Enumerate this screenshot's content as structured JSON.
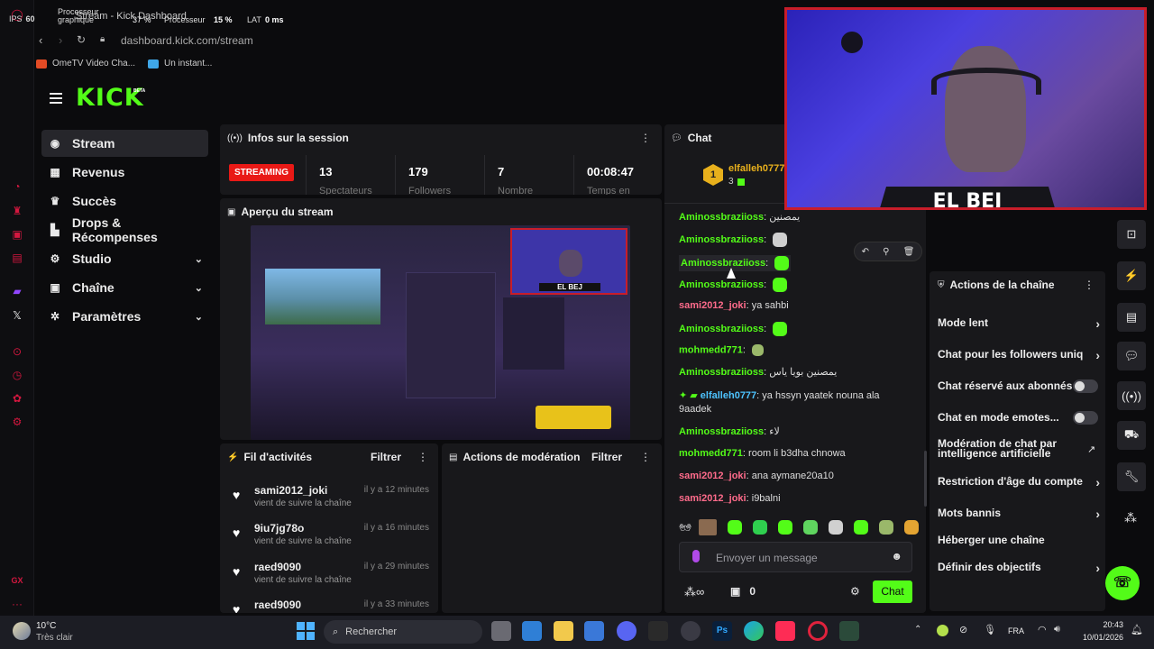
{
  "browser": {
    "perf": {
      "fps_label": "IPS",
      "fps_value": "60",
      "gpu_label": "Processeur graphique",
      "gpu_value": "37 %",
      "cpu_label": "Processeur",
      "cpu_value": "15 %",
      "lat_label": "LAT",
      "lat_value": "0 ms"
    },
    "tab_title": "Stream - Kick Dashboard",
    "url": "dashboard.kick.com/stream",
    "bookmarks": [
      "OmeTV Video Cha...",
      "Un instant..."
    ]
  },
  "sidebar": {
    "logo": "KICK",
    "beta": "BETA",
    "items": [
      {
        "label": "Stream",
        "icon": "broadcast-icon"
      },
      {
        "label": "Revenus",
        "icon": "chart-icon"
      },
      {
        "label": "Succès",
        "icon": "trophy-icon"
      },
      {
        "label": "Drops & Récompenses",
        "icon": "gift-icon"
      },
      {
        "label": "Studio",
        "icon": "gear-icon"
      },
      {
        "label": "Chaîne",
        "icon": "user-icon"
      },
      {
        "label": "Paramètres",
        "icon": "settings-icon"
      }
    ],
    "gx": "GX"
  },
  "session": {
    "title": "Infos sur la session",
    "badge": "STREAMING",
    "stats": [
      {
        "value": "13",
        "label": "Spectateurs"
      },
      {
        "value": "179",
        "label": "Followers"
      },
      {
        "value": "7",
        "label": "Nombre"
      },
      {
        "value": "00:08:47",
        "label": "Temps en"
      }
    ]
  },
  "preview": {
    "title": "Aperçu du stream",
    "overlay_name": "EL BEJ"
  },
  "feed": {
    "title": "Fil d'activités",
    "filter": "Filtrer",
    "items": [
      {
        "name": "sami2012_joki",
        "time": "il y a 12 minutes",
        "sub": "vient de suivre la chaîne"
      },
      {
        "name": "9iu7jg78o",
        "time": "il y a 16 minutes",
        "sub": "vient de suivre la chaîne"
      },
      {
        "name": "raed9090",
        "time": "il y a 29 minutes",
        "sub": "vient de suivre la chaîne"
      },
      {
        "name": "raed9090",
        "time": "il y a 33 minutes",
        "sub": ""
      }
    ]
  },
  "moderation": {
    "title": "Actions de modération",
    "filter": "Filtrer"
  },
  "chat": {
    "title": "Chat",
    "pinned_user": "elfalleh0777",
    "pinned_rank": "1",
    "pinned_count": "3",
    "messages": [
      {
        "user": "Aminossbraziioss",
        "text": "يمصنين",
        "color": "#53fc18"
      },
      {
        "user": "Aminossbraziioss",
        "text": "",
        "color": "#53fc18"
      },
      {
        "user": "Aminossbraziioss",
        "text": "",
        "color": "#53fc18"
      },
      {
        "user": "Aminossbraziioss",
        "text": "",
        "color": "#53fc18"
      },
      {
        "user": "sami2012_joki",
        "text": "ya sahbi",
        "color": "#ff6b8b"
      },
      {
        "user": "Aminossbraziioss",
        "text": "",
        "color": "#53fc18"
      },
      {
        "user": "mohmedd771",
        "text": "",
        "color": "#53fc18"
      },
      {
        "user": "Aminossbraziioss",
        "text": "يمصنين بويا ياس",
        "color": "#53fc18"
      },
      {
        "user": "elfalleh0777",
        "text": "ya hssyn yaatek nouna ala",
        "color": "#4dc3ff"
      },
      {
        "user": "",
        "text": "9aadek",
        "color": "#fff"
      },
      {
        "user": "Aminossbraziioss",
        "text": "لاء",
        "color": "#53fc18"
      },
      {
        "user": "mohmedd771",
        "text": "room li b3dha chnowa",
        "color": "#53fc18"
      },
      {
        "user": "sami2012_joki",
        "text": "ana aymane20a10",
        "color": "#ff6b8b"
      },
      {
        "user": "sami2012_joki",
        "text": "i9balni",
        "color": "#ff6b8b"
      }
    ],
    "placeholder": "Envoyer un message",
    "points": "0",
    "send": "Chat"
  },
  "actions": {
    "title": "Actions de la chaîne",
    "items": [
      {
        "label": "Mode lent",
        "control": "arrow"
      },
      {
        "label": "Chat pour les followers uniq",
        "control": "arrow"
      },
      {
        "label": "Chat réservé aux abonnés",
        "control": "toggle"
      },
      {
        "label": "Chat en mode emotes...",
        "control": "toggle"
      },
      {
        "label": "Modération de chat par intelligence artificielle",
        "control": "external"
      },
      {
        "label": "Restriction d'âge du compte",
        "control": "arrow"
      },
      {
        "label": "Mots bannis",
        "control": "arrow"
      },
      {
        "label": "Héberger une chaîne",
        "control": "none"
      },
      {
        "label": "Définir des objectifs",
        "control": "arrow"
      }
    ]
  },
  "webcam": {
    "name": "EL BEJ"
  },
  "taskbar": {
    "weather_temp": "10°C",
    "weather_desc": "Très clair",
    "search": "Rechercher",
    "lang": "FRA",
    "time": "20:43",
    "date": "10/01/2026"
  },
  "colors": {
    "brand": "#53fc18",
    "live": "#e91916",
    "accent": "#d4173f"
  }
}
